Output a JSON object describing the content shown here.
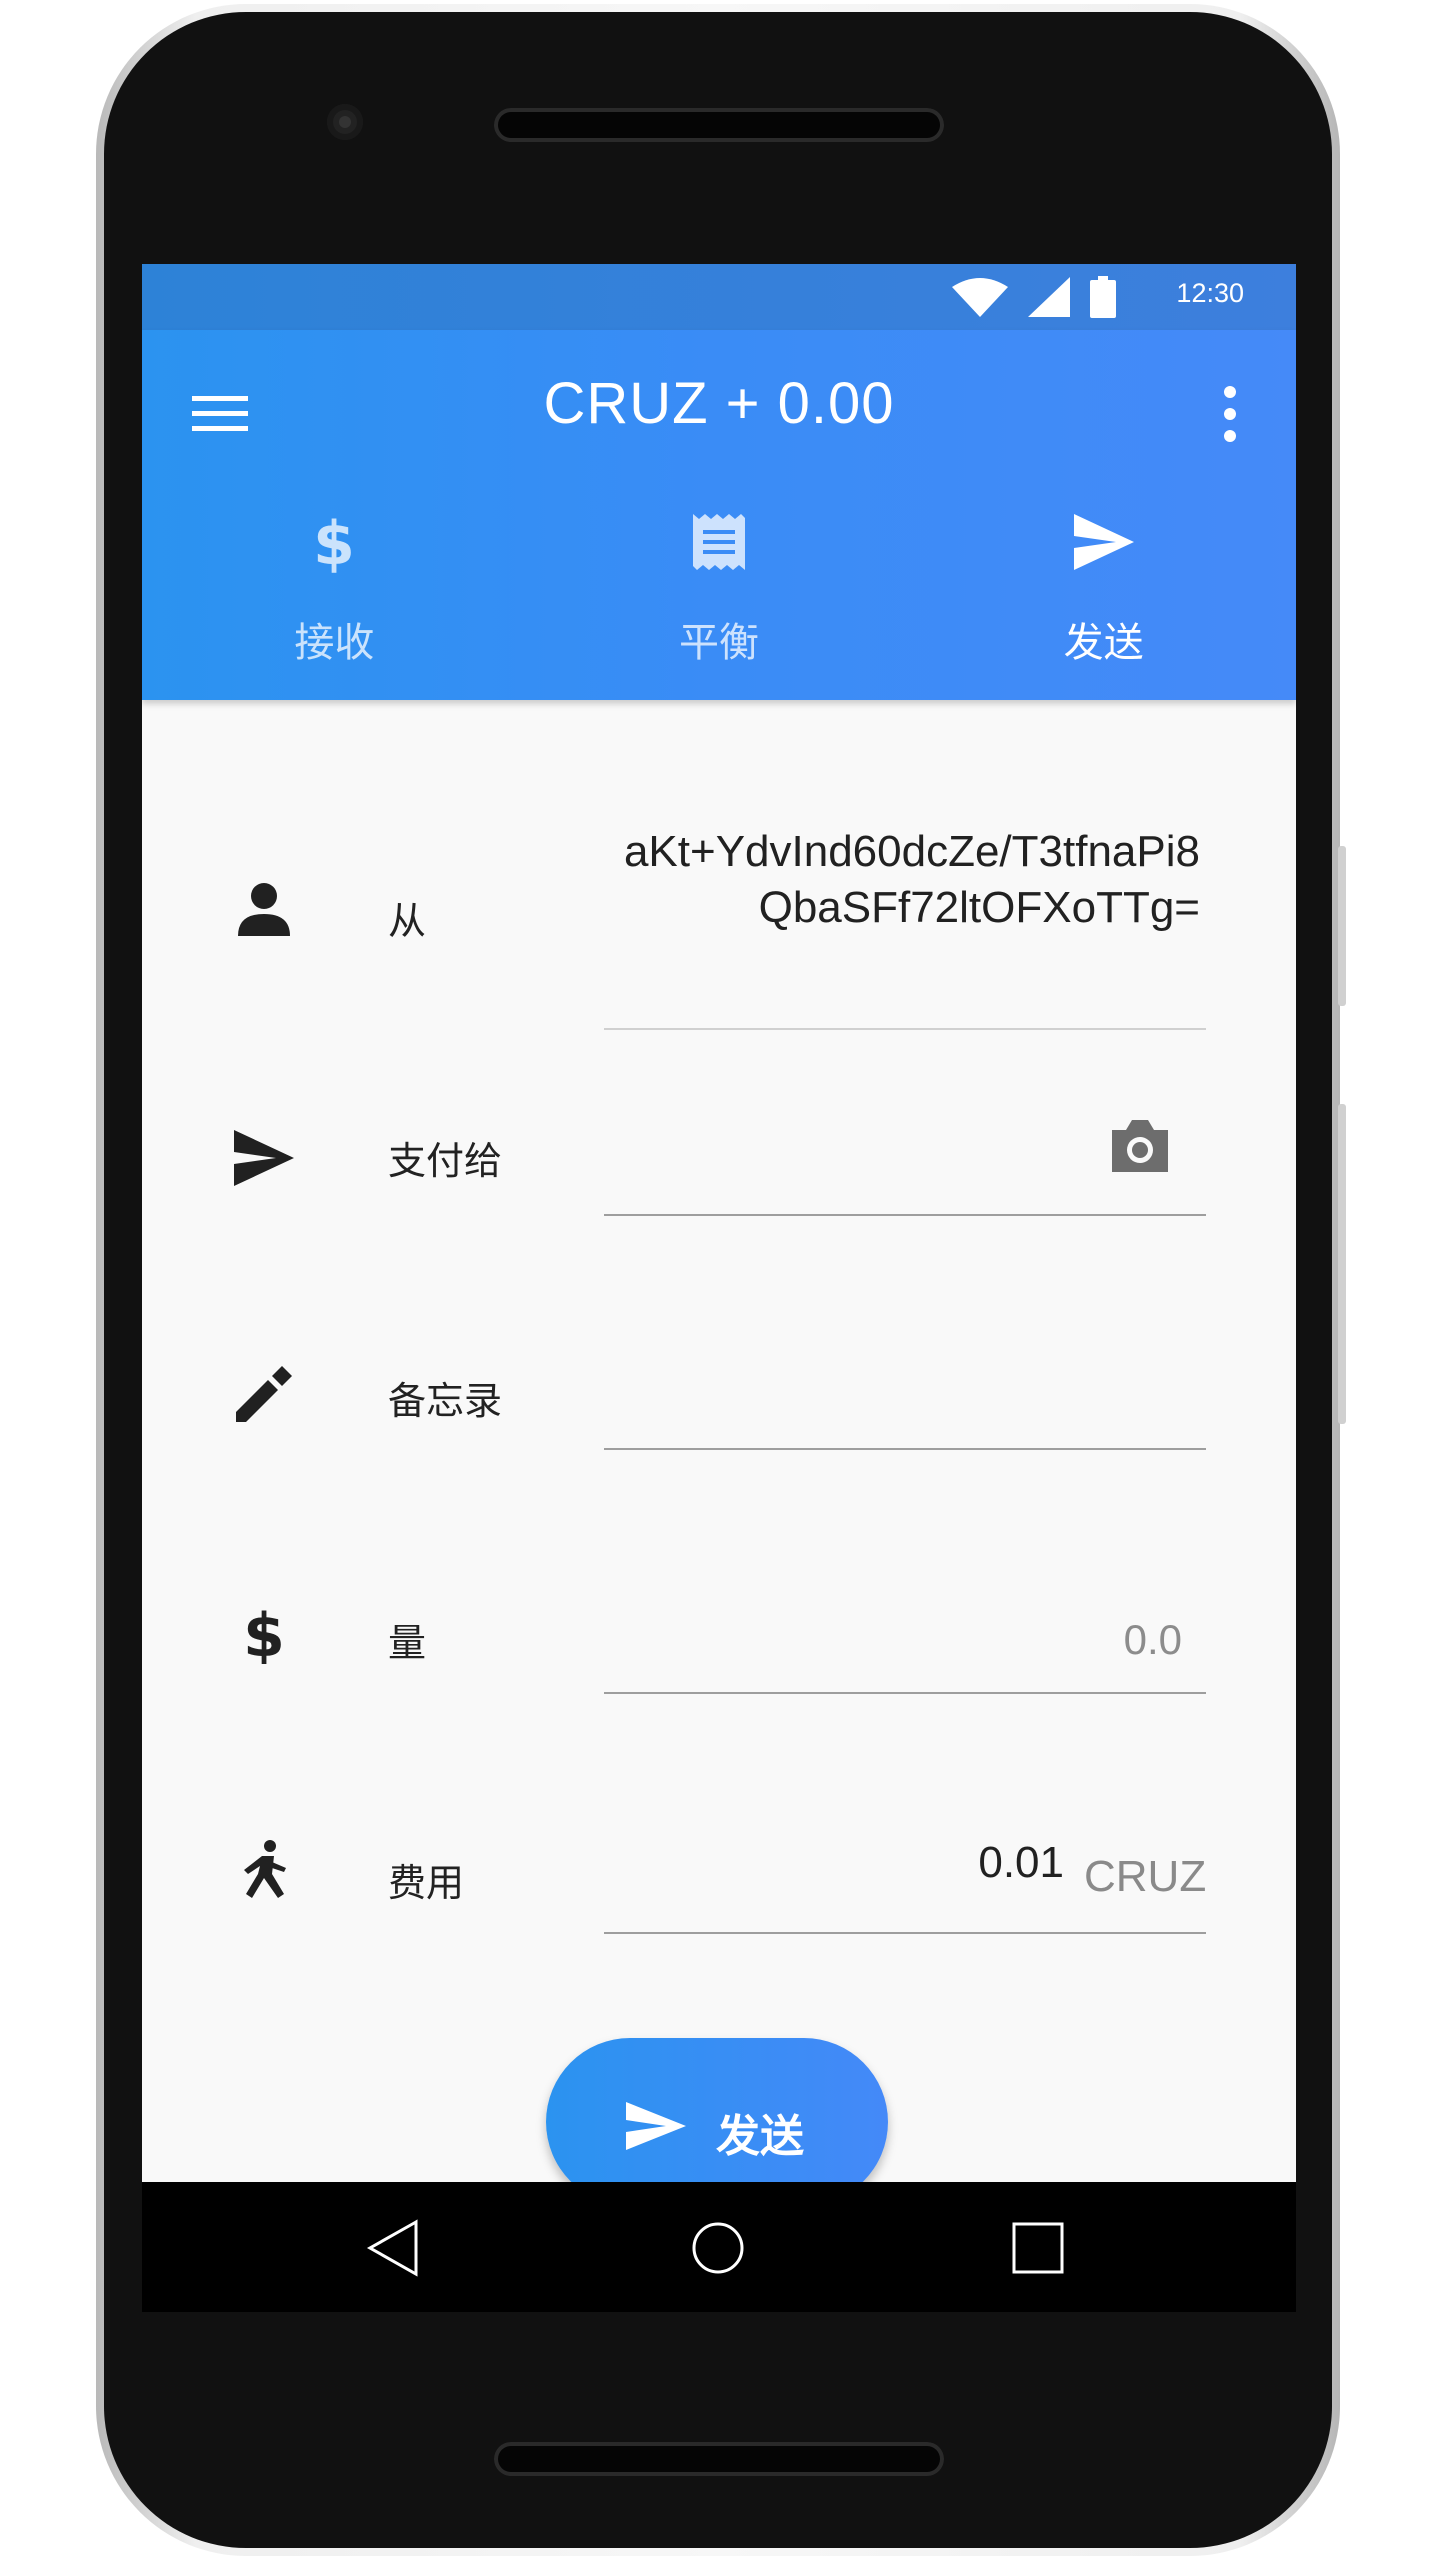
{
  "status_bar": {
    "time": "12:30"
  },
  "app_bar": {
    "title": "CRUZ + 0.00"
  },
  "tabs": [
    {
      "label": "接收",
      "icon": "dollar-icon",
      "active": false
    },
    {
      "label": "平衡",
      "icon": "receipt-icon",
      "active": false
    },
    {
      "label": "发送",
      "icon": "send-icon",
      "active": true
    }
  ],
  "form": {
    "from": {
      "label": "从",
      "value": "aKt+YdvInd60dcZe/T3tfnaPi8QbaSFf72ltOFXoTTg="
    },
    "pay_to": {
      "label": "支付给",
      "value": ""
    },
    "memo": {
      "label": "备忘录",
      "value": ""
    },
    "amount": {
      "label": "量",
      "placeholder": "0.0"
    },
    "fee": {
      "label": "费用",
      "value": "0.01",
      "unit": "CRUZ"
    }
  },
  "send_button": {
    "label": "发送"
  },
  "colors": {
    "primary_start": "#2b93f0",
    "primary_end": "#458af8",
    "background": "#f9f9f9"
  }
}
